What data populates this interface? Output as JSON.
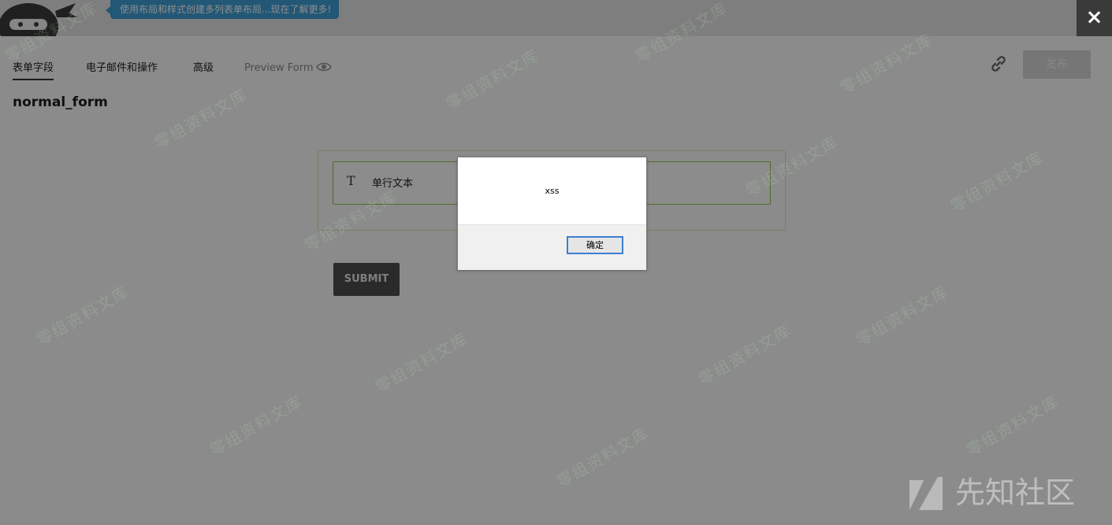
{
  "header": {
    "promo_text": "使用布局和样式创建多列表单布局...现在了解更多!",
    "close_icon": "×"
  },
  "tabs": [
    {
      "label": "表单字段",
      "active": true
    },
    {
      "label": "电子邮件和操作",
      "active": false
    },
    {
      "label": "高级",
      "active": false
    },
    {
      "label": "Preview Form",
      "active": false
    }
  ],
  "toolbar": {
    "publish_label": "发布"
  },
  "form": {
    "title": "normal_form",
    "fields": [
      {
        "type_icon": "T",
        "label": "单行文本"
      }
    ],
    "submit_label": "SUBMIT"
  },
  "alert": {
    "message": "xss",
    "ok_label": "确定"
  },
  "watermark": {
    "text": "零组资料文库",
    "brand": "先知社区"
  },
  "colors": {
    "promo": "#3e9fd6",
    "field_border": "#8cc63f",
    "submit": "#4d4d4d",
    "close": "#3a3a3a",
    "ok_border": "#3c7fce"
  }
}
